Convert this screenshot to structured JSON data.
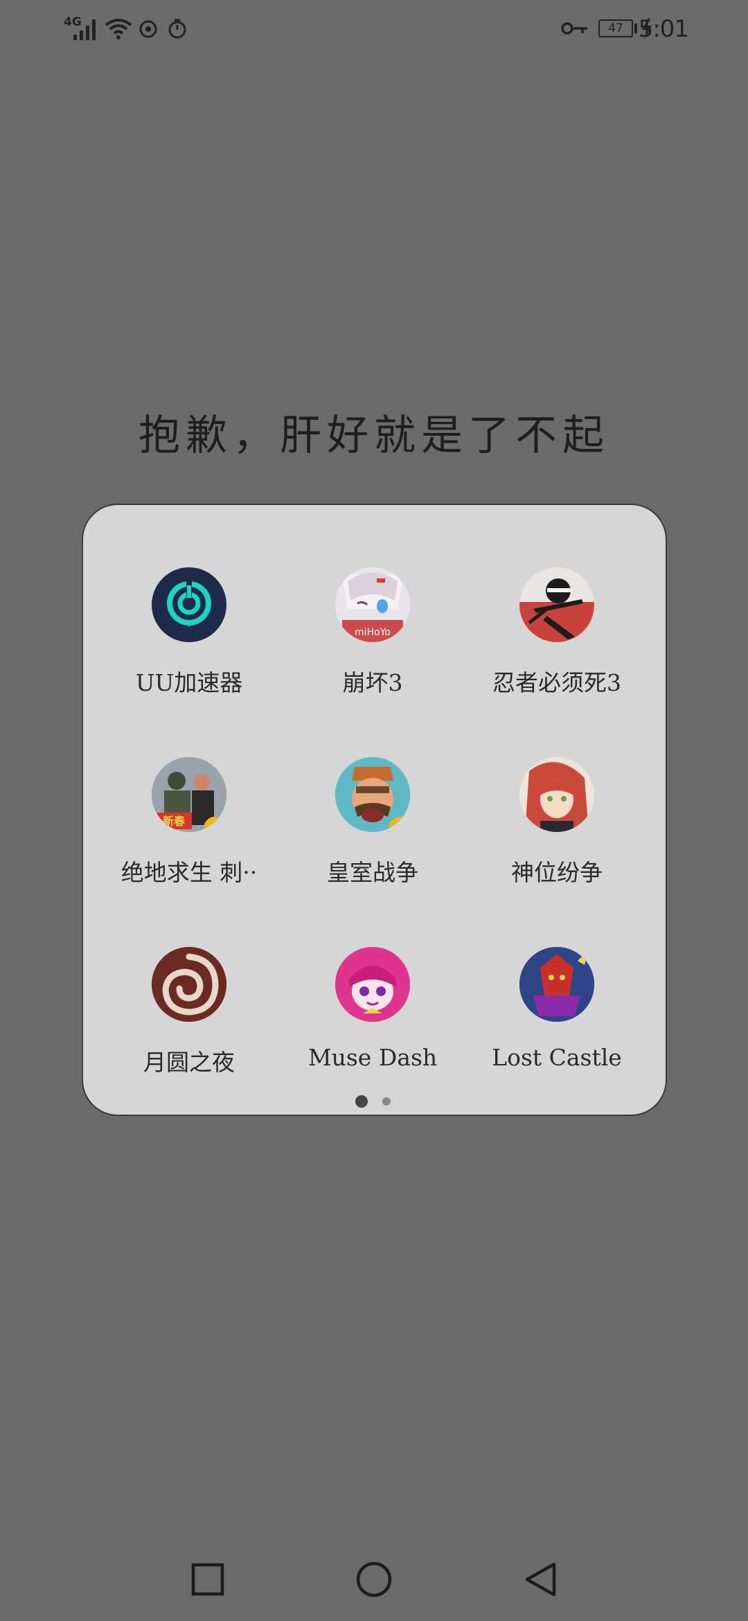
{
  "status_bar": {
    "network": "4G",
    "battery": "47",
    "time": "5:01"
  },
  "folder": {
    "title": "抱歉，肝好就是了不起",
    "apps": [
      {
        "label": "UU加速器"
      },
      {
        "label": "崩坏3"
      },
      {
        "label": "忍者必须死3"
      },
      {
        "label": "绝地求生 刺··"
      },
      {
        "label": "皇室战争"
      },
      {
        "label": "神位纷争"
      },
      {
        "label": "月圆之夜"
      },
      {
        "label": "Muse Dash"
      },
      {
        "label": "Lost Castle"
      }
    ],
    "page_indicator": {
      "current": 1,
      "total": 2
    }
  },
  "colors": {
    "background": "#6b6b6b",
    "panel": "#d6d6d6",
    "uu_bg": "#1e2a4a",
    "uu_ring": "#1fd3c4"
  }
}
